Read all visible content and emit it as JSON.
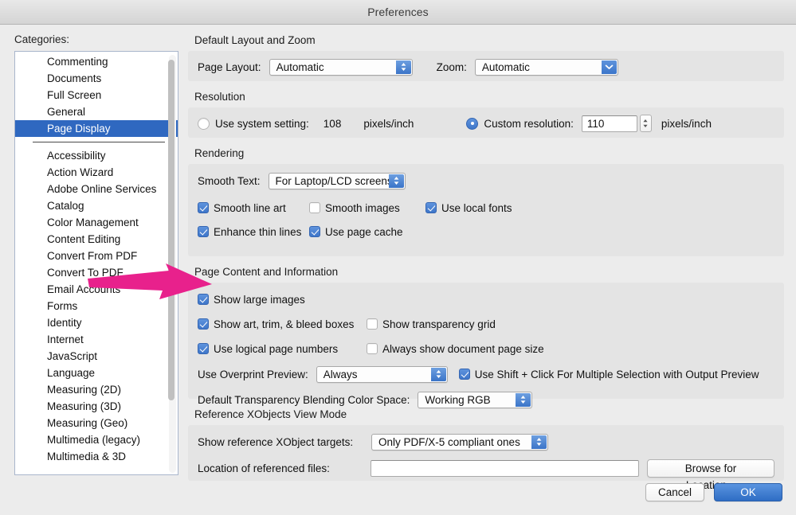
{
  "window": {
    "title": "Preferences"
  },
  "sidebar": {
    "label": "Categories:",
    "items_top": [
      {
        "label": "Commenting",
        "selected": false
      },
      {
        "label": "Documents",
        "selected": false
      },
      {
        "label": "Full Screen",
        "selected": false
      },
      {
        "label": "General",
        "selected": false
      },
      {
        "label": "Page Display",
        "selected": true
      }
    ],
    "items_bottom": [
      {
        "label": "Accessibility"
      },
      {
        "label": "Action Wizard"
      },
      {
        "label": "Adobe Online Services"
      },
      {
        "label": "Catalog"
      },
      {
        "label": "Color Management"
      },
      {
        "label": "Content Editing"
      },
      {
        "label": "Convert From PDF"
      },
      {
        "label": "Convert To PDF"
      },
      {
        "label": "Email Accounts"
      },
      {
        "label": "Forms"
      },
      {
        "label": "Identity"
      },
      {
        "label": "Internet"
      },
      {
        "label": "JavaScript"
      },
      {
        "label": "Language"
      },
      {
        "label": "Measuring (2D)"
      },
      {
        "label": "Measuring (3D)"
      },
      {
        "label": "Measuring (Geo)"
      },
      {
        "label": "Multimedia (legacy)"
      },
      {
        "label": "Multimedia & 3D"
      }
    ]
  },
  "sections": {
    "layout_zoom": {
      "title": "Default Layout and Zoom",
      "page_layout_label": "Page Layout:",
      "page_layout_value": "Automatic",
      "zoom_label": "Zoom:",
      "zoom_value": "Automatic"
    },
    "resolution": {
      "title": "Resolution",
      "system_label": "Use system setting:",
      "system_value": "108",
      "system_units": "pixels/inch",
      "system_selected": false,
      "custom_label": "Custom resolution:",
      "custom_value": "110",
      "custom_units": "pixels/inch",
      "custom_selected": true
    },
    "rendering": {
      "title": "Rendering",
      "smooth_text_label": "Smooth Text:",
      "smooth_text_value": "For Laptop/LCD screens",
      "checkboxes": [
        {
          "label": "Smooth line art",
          "checked": true
        },
        {
          "label": "Smooth images",
          "checked": false
        },
        {
          "label": "Use local fonts",
          "checked": true
        },
        {
          "label": "Enhance thin lines",
          "checked": true
        },
        {
          "label": "Use page cache",
          "checked": true
        }
      ]
    },
    "page_content": {
      "title": "Page Content and Information",
      "show_large_images": {
        "label": "Show large images",
        "checked": true
      },
      "show_art_boxes": {
        "label": "Show art, trim, & bleed boxes",
        "checked": true
      },
      "show_transparency_grid": {
        "label": "Show transparency grid",
        "checked": false
      },
      "use_logical_page_numbers": {
        "label": "Use logical page numbers",
        "checked": true
      },
      "always_show_page_size": {
        "label": "Always show document page size",
        "checked": false
      },
      "overprint_label": "Use Overprint Preview:",
      "overprint_value": "Always",
      "shift_click": {
        "label": "Use Shift + Click For Multiple Selection with Output Preview",
        "checked": true
      },
      "blending_label": "Default Transparency Blending Color Space:",
      "blending_value": "Working RGB"
    },
    "xobjects": {
      "title": "Reference XObjects View Mode",
      "targets_label": "Show reference XObject targets:",
      "targets_value": "Only PDF/X-5 compliant ones",
      "location_label": "Location of referenced files:",
      "location_value": "",
      "location_placeholder": "",
      "browse_label": "Browse for Location..."
    }
  },
  "footer": {
    "cancel_label": "Cancel",
    "ok_label": "OK"
  },
  "annotation": {
    "arrow_color": "#e8218c",
    "points_to": "Show large images"
  },
  "colors": {
    "accent_blue": "#3a74c8",
    "selection_blue": "#2f68c0",
    "annotation_pink": "#e8218c",
    "panel_bg": "#e4e4e4",
    "window_bg": "#ececec"
  }
}
